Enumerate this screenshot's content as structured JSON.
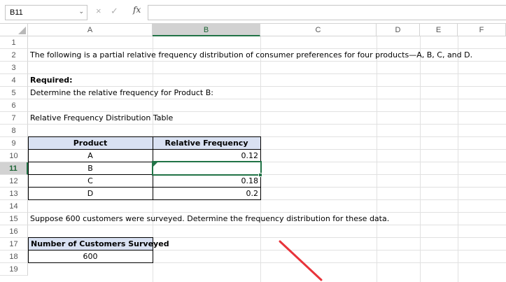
{
  "formula_bar": {
    "name_box": "B11",
    "fx_label": "fx",
    "formula": ""
  },
  "columns": [
    "A",
    "B",
    "C",
    "D",
    "E",
    "F"
  ],
  "rows": [
    "1",
    "2",
    "3",
    "4",
    "5",
    "6",
    "7",
    "8",
    "9",
    "10",
    "11",
    "12",
    "13",
    "14",
    "15",
    "16",
    "17",
    "18",
    "19"
  ],
  "cells": {
    "a2": "The following is a partial relative frequency distribution of consumer preferences for four products—A, B, C, and D.",
    "a4": "Required:",
    "a5": "Determine the relative frequency for Product B:",
    "a7": "Relative Frequency Distribution Table",
    "a9": "Product",
    "b9": "Relative Frequency",
    "a10": "A",
    "b10": "0.12",
    "a11": "B",
    "b11": "",
    "a12": "C",
    "b12": "0.18",
    "a13": "D",
    "b13": "0.2",
    "a15": "Suppose 600 customers were surveyed. Determine the frequency distribution for these data.",
    "a17": "Number of Customers Surveyed",
    "a18": "600"
  },
  "colors": {
    "selection": "#217346",
    "header_fill": "#d9e1f2",
    "annotation": "#e8333a"
  },
  "icons": {
    "cancel": "×",
    "enter": "✓",
    "dropdown": "⌄"
  }
}
